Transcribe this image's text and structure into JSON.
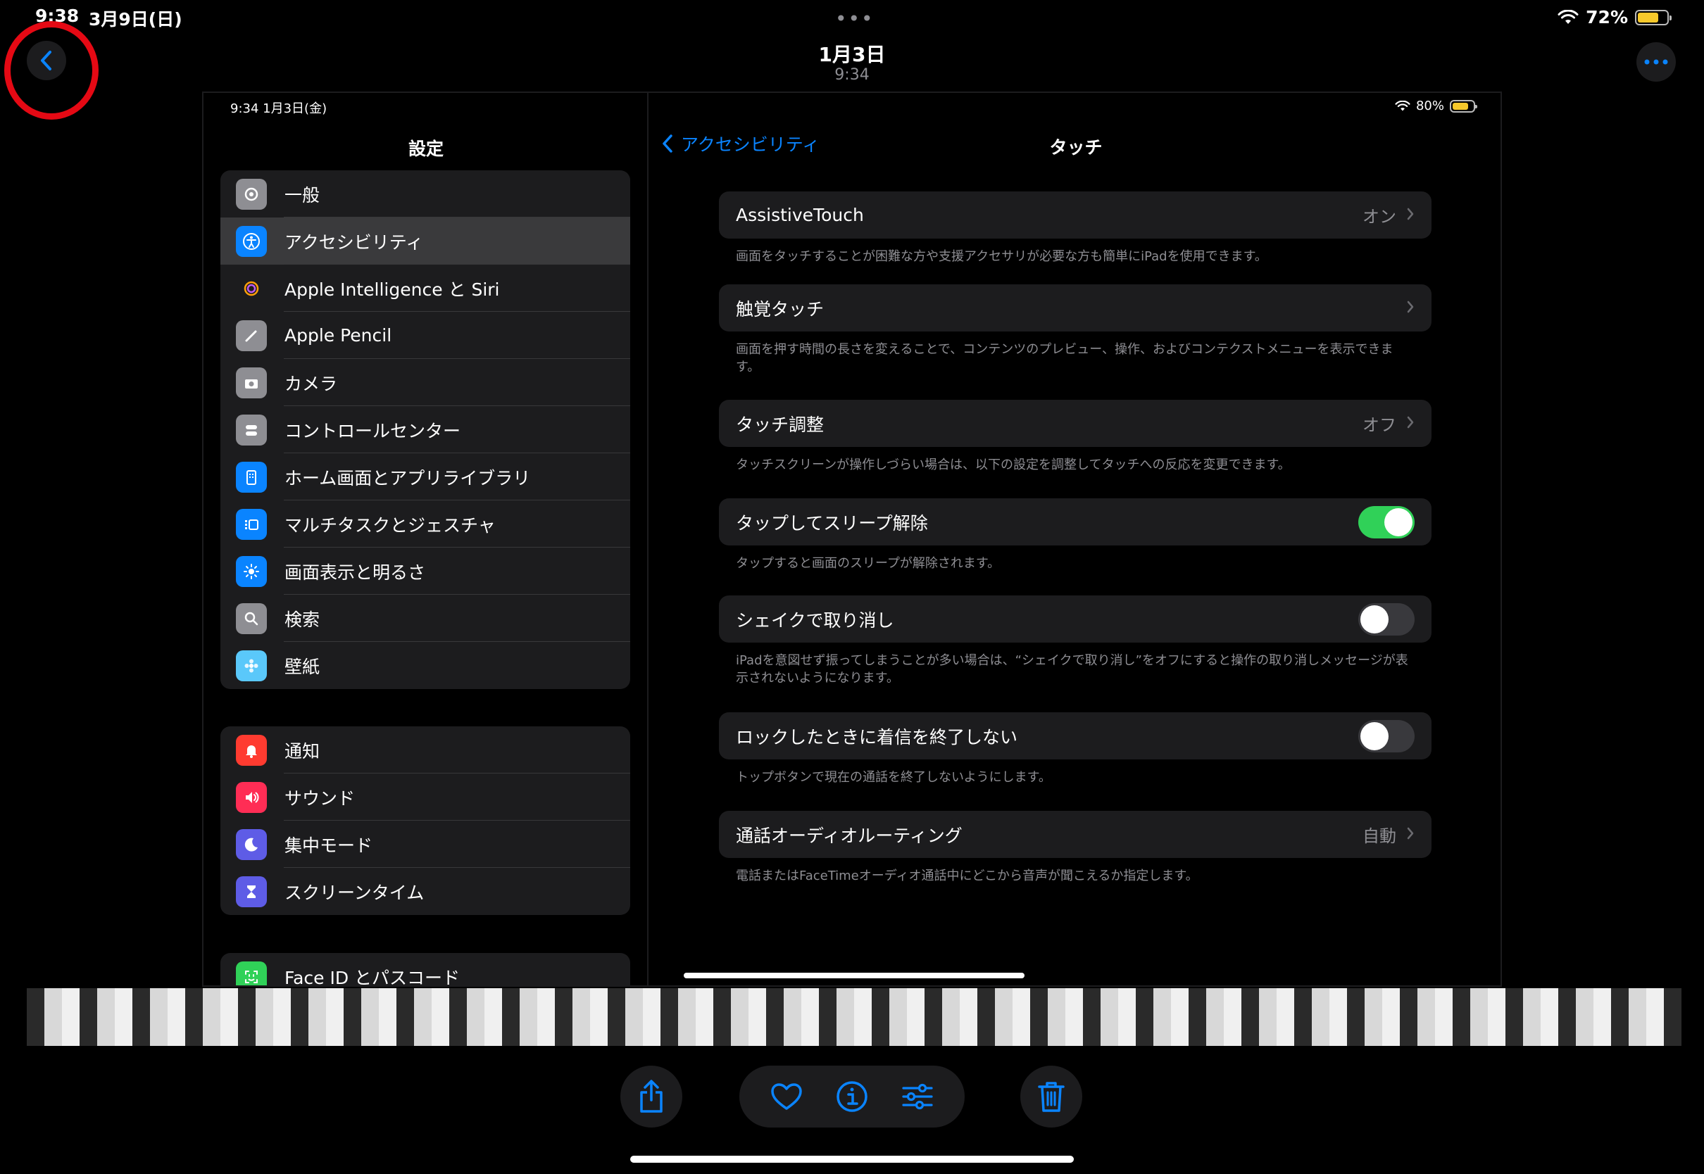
{
  "status_bar": {
    "time": "9:38",
    "date": "3月9日(日)",
    "battery_percent": "72%",
    "battery_level": 0.72
  },
  "photo": {
    "title": "1月3日",
    "subtitle": "9:34"
  },
  "screenshot": {
    "sidebar_status": "9:34   1月3日(金)",
    "sidebar_title": "設定",
    "groups": [
      [
        {
          "label": "一般",
          "icon": "gear-icon",
          "color": "#8e8e93"
        },
        {
          "label": "アクセシビリティ",
          "icon": "accessibility-icon",
          "color": "#0a84ff",
          "selected": true
        },
        {
          "label": "Apple Intelligence と Siri",
          "icon": "apple-intelligence-icon",
          "color": "#1c1c1e"
        },
        {
          "label": "Apple Pencil",
          "icon": "pencil-icon",
          "color": "#8e8e93"
        },
        {
          "label": "カメラ",
          "icon": "camera-icon",
          "color": "#8e8e93"
        },
        {
          "label": "コントロールセンター",
          "icon": "control-center-icon",
          "color": "#8e8e93"
        },
        {
          "label": "ホーム画面とアプリライブラリ",
          "icon": "home-screen-icon",
          "color": "#0a84ff"
        },
        {
          "label": "マルチタスクとジェスチャ",
          "icon": "multitask-icon",
          "color": "#0a84ff"
        },
        {
          "label": "画面表示と明るさ",
          "icon": "brightness-icon",
          "color": "#0a84ff"
        },
        {
          "label": "検索",
          "icon": "search-icon",
          "color": "#8e8e93"
        },
        {
          "label": "壁紙",
          "icon": "wallpaper-icon",
          "color": "#5ac8fa"
        }
      ],
      [
        {
          "label": "通知",
          "icon": "bell-icon",
          "color": "#ff3b30"
        },
        {
          "label": "サウンド",
          "icon": "speaker-icon",
          "color": "#ff2d55"
        },
        {
          "label": "集中モード",
          "icon": "moon-icon",
          "color": "#5e5ce6"
        },
        {
          "label": "スクリーンタイム",
          "icon": "hourglass-icon",
          "color": "#5e5ce6"
        }
      ],
      [
        {
          "label": "Face ID とパスコード",
          "icon": "face-id-icon",
          "color": "#30d158"
        }
      ]
    ],
    "detail_status": {
      "battery_percent": "80%",
      "battery_level": 0.8
    },
    "back_label": "アクセシビリティ",
    "detail_title": "タッチ",
    "settings": [
      {
        "label": "AssistiveTouch",
        "value": "オン",
        "type": "link",
        "footer": "画面をタッチすることが困難な方や支援アクセサリが必要な方も簡単にiPadを使用できます。"
      },
      {
        "label": "触覚タッチ",
        "value": "",
        "type": "link",
        "footer": "画面を押す時間の長さを変えることで、コンテンツのプレビュー、操作、およびコンテクストメニューを表示できます。"
      },
      {
        "label": "タッチ調整",
        "value": "オフ",
        "type": "link",
        "footer": "タッチスクリーンが操作しづらい場合は、以下の設定を調整してタッチへの反応を変更できます。"
      },
      {
        "label": "タップしてスリープ解除",
        "type": "toggle",
        "on": true,
        "footer": "タップすると画面のスリープが解除されます。"
      },
      {
        "label": "シェイクで取り消し",
        "type": "toggle",
        "on": false,
        "footer": "iPadを意図せず振ってしまうことが多い場合は、“シェイクで取り消し”をオフにすると操作の取り消しメッセージが表示されないようになります。"
      },
      {
        "label": "ロックしたときに着信を終了しない",
        "type": "toggle",
        "on": false,
        "footer": "トップボタンで現在の通話を終了しないようにします。"
      },
      {
        "label": "通話オーディオルーティング",
        "value": "自動",
        "type": "link",
        "footer": "電話またはFaceTimeオーディオ通話中にどこから音声が聞こえるか指定します。"
      }
    ]
  },
  "colors": {
    "accent": "#0a84ff",
    "toggle_on": "#30d158",
    "highlight_circle": "#e50914"
  }
}
